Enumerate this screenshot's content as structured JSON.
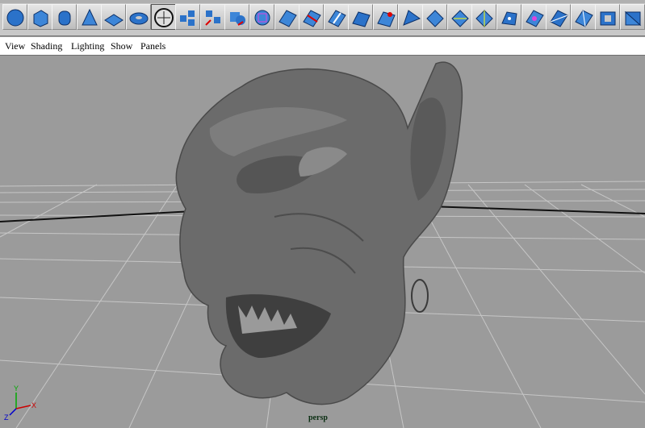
{
  "shelf": {
    "tools": [
      {
        "icon": "polygon-sphere-icon"
      },
      {
        "icon": "polygon-cube-icon"
      },
      {
        "icon": "polygon-cylinder-icon"
      },
      {
        "icon": "polygon-cone-icon"
      },
      {
        "icon": "polygon-plane-icon"
      },
      {
        "icon": "polygon-torus-icon"
      },
      {
        "icon": "select-edge-loop-icon",
        "active": true
      },
      {
        "icon": "combine-polygons-icon"
      },
      {
        "icon": "separate-polygons-icon"
      },
      {
        "icon": "boolean-union-icon"
      },
      {
        "icon": "smooth-polygon-icon"
      },
      {
        "icon": "extrude-face-icon"
      },
      {
        "icon": "split-polygon-icon"
      },
      {
        "icon": "insert-edge-loop-icon"
      },
      {
        "icon": "append-polygon-icon"
      },
      {
        "icon": "merge-vertices-icon"
      },
      {
        "icon": "wedge-face-icon"
      },
      {
        "icon": "bevel-icon"
      },
      {
        "icon": "cut-faces-icon"
      },
      {
        "icon": "subdivide-face-icon"
      },
      {
        "icon": "extract-faces-icon"
      },
      {
        "icon": "poke-face-icon"
      },
      {
        "icon": "chamfer-vertex-icon"
      },
      {
        "icon": "mirror-geometry-icon"
      },
      {
        "icon": "fill-hole-icon"
      },
      {
        "icon": "triangulate-icon"
      }
    ]
  },
  "menubar": {
    "items": [
      "View",
      "Shading",
      "Lighting",
      "Show",
      "Panels"
    ]
  },
  "viewport": {
    "camera_name": "persp",
    "axes": {
      "x": "X",
      "y": "Y",
      "z": "Z"
    },
    "colors": {
      "background": "#9b9b9b",
      "grid": "#c9c9c9",
      "horizon": "#000000",
      "model": "#6e6e6e"
    }
  }
}
